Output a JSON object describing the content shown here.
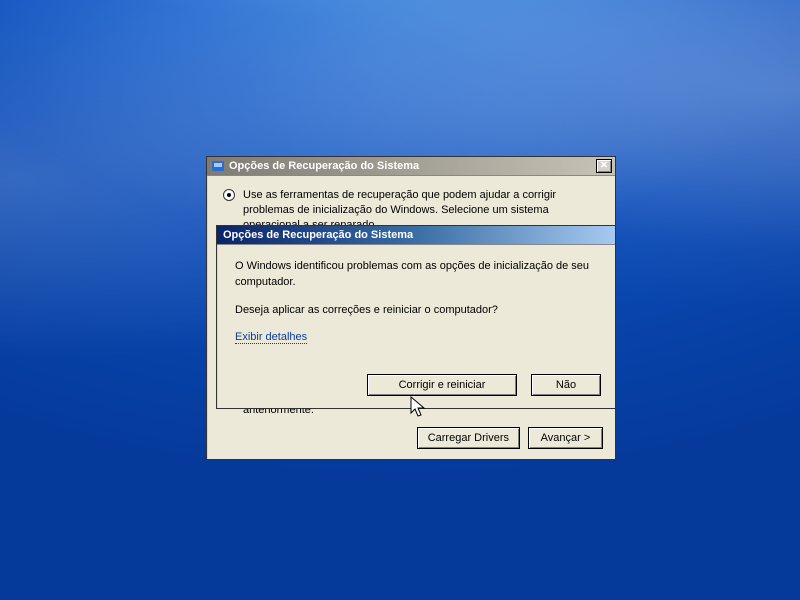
{
  "main_window": {
    "title": "Opções de Recuperação do Sistema",
    "option1_label": "Use as ferramentas de recuperação que podem ajudar a corrigir problemas de inicialização do Windows. Selecione um sistema operacional a ser reparado.",
    "option2_label": "Restaurar seu computador usando uma imagem do sistema criada anteriormente.",
    "load_drivers_label": "Carregar Drivers",
    "next_label": "Avançar >"
  },
  "inner_dialog": {
    "title": "Opções de Recuperação do Sistema",
    "message1": "O Windows identificou problemas com as opções de inicialização de seu computador.",
    "message2": "Deseja aplicar as correções e reiniciar o computador?",
    "details_link": "Exibir detalhes",
    "repair_label": "Corrigir e reiniciar",
    "no_label": "Não"
  }
}
